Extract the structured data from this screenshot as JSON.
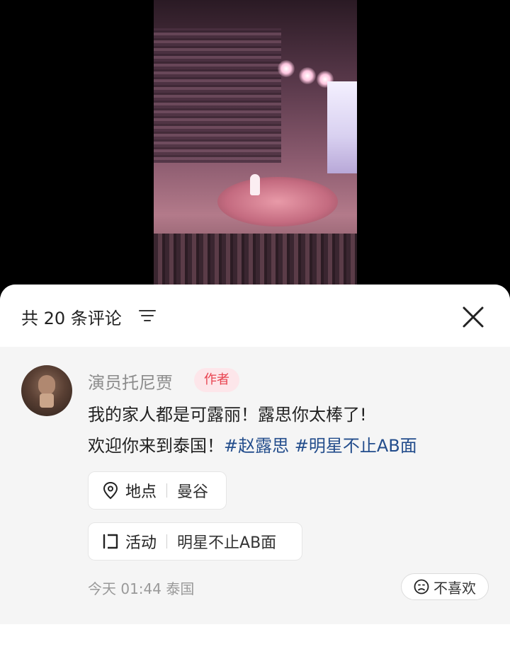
{
  "sheet": {
    "comment_count_label": "共 20 条评论"
  },
  "post": {
    "author": "演员托尼贾",
    "author_badge": "作者",
    "text_line1": "我的家人都是可露丽！露思你太棒了!",
    "text_line2_prefix": "欢迎你来到泰国！",
    "hashtags": [
      "#赵露思",
      "#明星不止AB面"
    ],
    "location": {
      "label": "地点",
      "value": "曼谷"
    },
    "activity": {
      "label": "活动",
      "value": "明星不止AB面"
    },
    "meta": "今天 01:44 泰国",
    "dislike_label": "不喜欢"
  },
  "icons": {
    "sort": "filter-lines-icon",
    "close": "close-icon",
    "location": "location-pin-icon",
    "activity": "activity-flag-icon",
    "dislike": "frown-face-icon"
  },
  "colors": {
    "hashtag": "#234d8c",
    "badge_text": "#e8424f",
    "badge_bg": "#fde6ea"
  }
}
